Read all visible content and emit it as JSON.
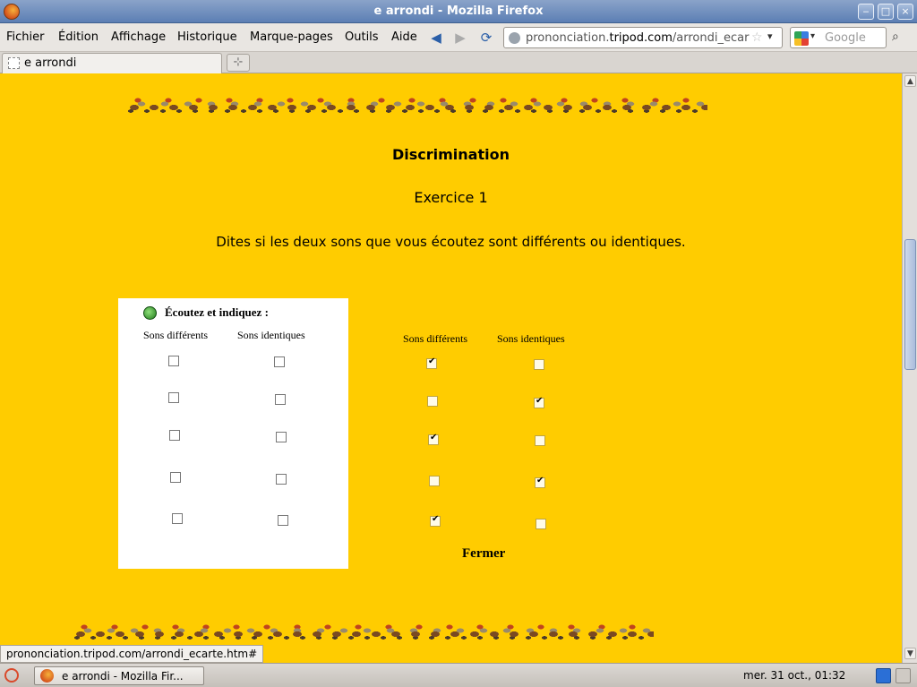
{
  "window": {
    "title": "e arrondi - Mozilla Firefox"
  },
  "menubar": {
    "items": [
      {
        "label": "Fichier"
      },
      {
        "label": "Édition"
      },
      {
        "label": "Affichage"
      },
      {
        "label": "Historique"
      },
      {
        "label": "Marque-pages"
      },
      {
        "label": "Outils"
      },
      {
        "label": "Aide"
      }
    ],
    "url_host_prefix": "prononciation.",
    "url_host": "tripod.com",
    "url_path": "/arrondi_ecar",
    "search_placeholder": "Google"
  },
  "tabs": [
    {
      "label": "e arrondi"
    }
  ],
  "page": {
    "heading": "Discrimination",
    "subheading": "Exercice 1",
    "instruction": "Dites si les deux sons que vous écoutez sont différents ou identiques.",
    "panel": {
      "listen_label": "Écoutez  et indiquez :",
      "col_different": "Sons différents",
      "col_identical": "Sons identiques"
    },
    "answers": {
      "col_different": "Sons différents",
      "col_identical": "Sons identiques",
      "rows": [
        {
          "different": true,
          "identical": false
        },
        {
          "different": false,
          "identical": true
        },
        {
          "different": true,
          "identical": false
        },
        {
          "different": false,
          "identical": true
        },
        {
          "different": true,
          "identical": false
        }
      ]
    },
    "close_label": "Fermer"
  },
  "status": {
    "link": "prononciation.tripod.com/arrondi_ecarte.htm#"
  },
  "taskbar": {
    "task_label": "e arrondi - Mozilla Fir...",
    "clock": "mer. 31 oct., 01:32"
  },
  "icons": {
    "back": "back-arrow-icon",
    "forward": "forward-arrow-icon",
    "reload": "reload-icon",
    "star": "bookmark-star-icon",
    "search": "binoculars-icon",
    "listen": "play-sound-icon"
  }
}
